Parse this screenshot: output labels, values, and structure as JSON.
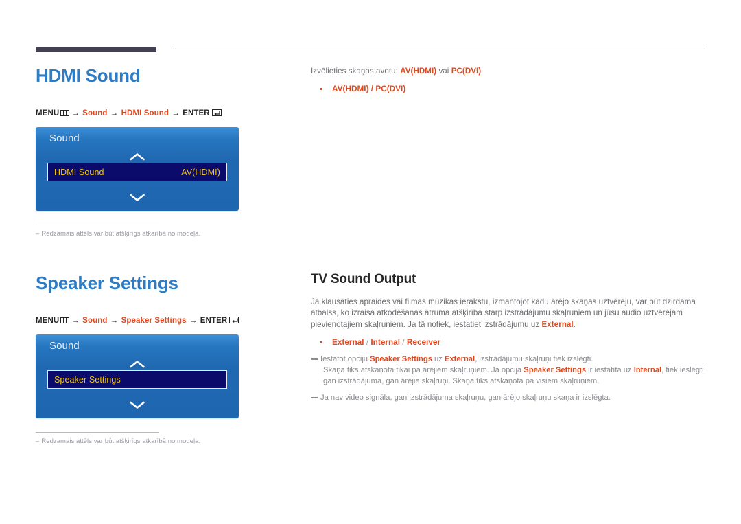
{
  "header": {
    "bar_left_name": "header-accent-bar",
    "bar_right_name": "header-rule"
  },
  "colors": {
    "title_blue": "#2e7cc4",
    "accent_orange": "#e0491f",
    "osd_blue": "#1f66b0",
    "osd_row_navy": "#0b0b6b",
    "osd_row_text": "#f1c40f",
    "dark_bar": "#434050"
  },
  "sections": [
    {
      "id": "hdmi-sound",
      "title": "HDMI Sound",
      "menu_path": {
        "menu_label": "MENU",
        "menu_icon": "menu-grid-icon",
        "arrow": "→",
        "steps": [
          "Sound",
          "HDMI Sound"
        ],
        "enter_label": "ENTER",
        "enter_icon": "enter-return-icon"
      },
      "osd": {
        "title": "Sound",
        "up_icon": "chevron-up-icon",
        "down_icon": "chevron-down-icon",
        "row_label": "HDMI Sound",
        "row_value": "AV(HDMI)"
      },
      "footnote": {
        "dash": "–",
        "text": "Redzamais attēls var būt atšķirīgs atkarībā no modeļa."
      },
      "right": {
        "intro_before": "Izvēlieties skaņas avotu: ",
        "intro_bold1": "AV(HDMI)",
        "intro_mid": " vai ",
        "intro_bold2": "PC(DVI)",
        "intro_after": ".",
        "options": [
          "AV(HDMI) / PC(DVI)"
        ]
      }
    },
    {
      "id": "speaker-settings",
      "title": "Speaker Settings",
      "menu_path": {
        "menu_label": "MENU",
        "menu_icon": "menu-grid-icon",
        "arrow": "→",
        "steps": [
          "Sound",
          "Speaker Settings"
        ],
        "enter_label": "ENTER",
        "enter_icon": "enter-return-icon"
      },
      "osd": {
        "title": "Sound",
        "up_icon": "chevron-up-icon",
        "down_icon": "chevron-down-icon",
        "row_label": "Speaker Settings",
        "row_value": ""
      },
      "footnote": {
        "dash": "–",
        "text": "Redzamais attēls var būt atšķirīgs atkarībā no modeļa."
      },
      "right": {
        "subtitle": "TV Sound Output",
        "paragraph_1": "Ja klausāties apraides vai filmas mūzikas ierakstu, izmantojot kādu ārējo skaņas uztvērēju, var būt dzirdama atbalss, ko izraisa atkodēšanas ātruma atšķirība starp izstrādājumu skaļruņiem un jūsu audio uztvērējam pievienotajiem skaļruņiem. Ja tā notiek, iestatiet izstrādājumu uz ",
        "paragraph_1_bold": "External",
        "paragraph_1_end": ".",
        "options_line": {
          "opt1": "External",
          "sep1": " / ",
          "opt2": "Internal",
          "sep2": " / ",
          "opt3": "Receiver"
        },
        "note_1": {
          "t1": "Iestatot opciju ",
          "b1": "Speaker Settings",
          "t2": " uz ",
          "b2": "External",
          "t3": ", izstrādājumu skaļruņi tiek izslēgti.",
          "t4": "Skaņa tiks atskaņota tikai pa ārējiem skaļruņiem. Ja opcija ",
          "b3": "Speaker Settings",
          "t5": " ir iestatīta uz ",
          "b4": "Internal",
          "t6": ", tiek ieslēgti gan izstrādājuma, gan ārējie skaļruņi. Skaņa tiks atskaņota pa visiem skaļruņiem."
        },
        "note_2": {
          "t1": "Ja nav video signāla, gan izstrādājuma skaļruņu, gan ārējo skaļruņu skaņa ir izslēgta."
        }
      }
    }
  ]
}
